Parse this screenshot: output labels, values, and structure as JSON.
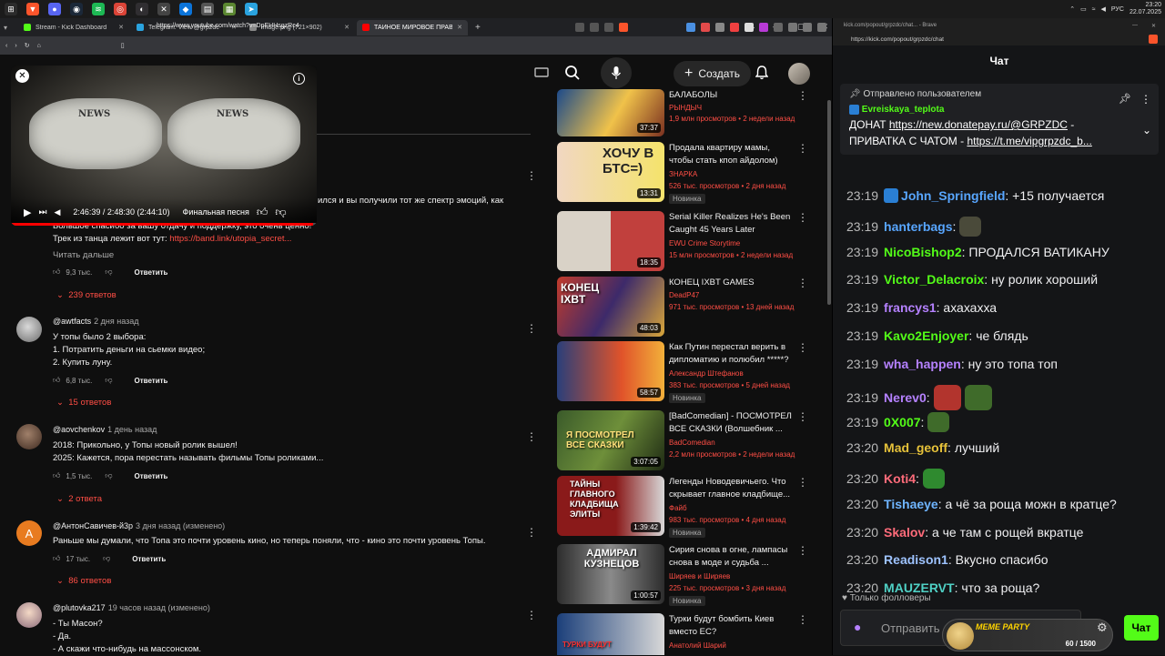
{
  "taskbar": {
    "clock_time": "23:20",
    "clock_date": "22.07.2025",
    "lang": "РУС"
  },
  "browser": {
    "tabs": [
      {
        "label": "Stream - Kick Dashboard",
        "color": "#53fc18"
      },
      {
        "label": "Telegram: View @grpzdc",
        "color": "#2aa3df"
      },
      {
        "label": "image.png (721×902)",
        "color": "#888888"
      },
      {
        "label": "ТАЙНОЕ МИРОВОЕ ПРАВИТЕЛ...",
        "color": "#ff0000"
      }
    ],
    "url": "https://www.youtube.com/watch?v=DpEHHsgzRc4"
  },
  "yt": {
    "create_label": "Создать",
    "miniplayer": {
      "time": "2:46:39 / 2:48:30 (2:44:10)",
      "chapter": "Финальная песня",
      "progress": 0.988,
      "newspaper_word": "NEWS"
    },
    "top_comment": {
      "line1": "ился и вы получили тот же спектр эмоций, как",
      "line2": "Большое спасибо за вашу отдачу и поддержку, это очень ценно!",
      "line3_prefix": "Трек из танца лежит вот тут: ",
      "line3_link": "https://band.link/utopia_secret...",
      "read_more": "Читать дальше",
      "likes": "9,3 тыс.",
      "reply": "Ответить",
      "replies": "239 ответов"
    },
    "comments": [
      {
        "author": "@awtfacts",
        "time": "2 дня назад",
        "lines": [
          "У топы было 2 выбора:",
          "1. Потратить деньги на сьемки видео;",
          "2. Купить луну."
        ],
        "likes": "6,8 тыс.",
        "reply": "Ответить",
        "replies": "15 ответов"
      },
      {
        "author": "@aovchenkov",
        "time": "1 день назад",
        "lines": [
          "2018: Прикольно, у Топы новый ролик вышел!",
          "2025: Кажется, пора перестать называть фильмы Топы роликами..."
        ],
        "likes": "1,5 тыс.",
        "reply": "Ответить",
        "replies": "2 ответа"
      },
      {
        "author": "@АнтонСавичев-й3р",
        "time": "3 дня назад (изменено)",
        "lines": [
          "Раньше мы думали, что Топа это почти уровень кино, но теперь поняли, что - кино это почти уровень Топы."
        ],
        "likes": "17 тыс.",
        "reply": "Ответить",
        "replies": "86 ответов",
        "avatar_letter": "А"
      },
      {
        "author": "@plutovka217",
        "time": "19 часов назад (изменено)",
        "lines": [
          "- Ты Масон?",
          "- Да.",
          "- А скажи что-нибудь на массонском."
        ]
      }
    ],
    "recommended": [
      {
        "title_lines": [
          "БАЛАБОЛЫ"
        ],
        "channel": "РЫНДЫЧ",
        "meta": "1,9 млн просмотров • 2 недели назад",
        "duration": "37:37"
      },
      {
        "title_lines": [
          "Продала квартиру мамы,",
          "чтобы стать кпоп айдолом)"
        ],
        "channel": "ЗНАРКА",
        "meta": "526 тыс. просмотров • 2 дня назад",
        "duration": "13:31",
        "badge": "Новинка",
        "thumb_text": "ХОЧУ В БТС=)"
      },
      {
        "title_lines": [
          "Serial Killer Realizes He's Been",
          "Caught 45 Years Later"
        ],
        "channel": "EWU Crime Storytime",
        "meta": "15 млн просмотров • 2 недели назад",
        "duration": "18:35"
      },
      {
        "title_lines": [
          "КОНЕЦ IXBT GAMES"
        ],
        "channel": "DeadP47",
        "meta": "971 тыс. просмотров • 13 дней назад",
        "duration": "48:03",
        "thumb_text": "КОНЕЦ IXBT"
      },
      {
        "title_lines": [
          "Как Путин перестал верить в",
          "дипломатию и полюбил *****?"
        ],
        "channel": "Александр Штефанов",
        "meta": "383 тыс. просмотров • 5 дней назад",
        "duration": "58:57",
        "badge": "Новинка"
      },
      {
        "title_lines": [
          "[BadComedian] - ПОСМОТРЕЛ",
          "ВСЕ СКАЗКИ (Волшебник ..."
        ],
        "channel": "BadComedian",
        "meta": "2,2 млн просмотров • 2 недели назад",
        "duration": "3:07:05",
        "thumb_text": "Я ПОСМОТРЕЛ ВСЕ СКАЗКИ"
      },
      {
        "title_lines": [
          "Легенды Новодевичьего. Что",
          "скрывает главное кладбище..."
        ],
        "channel": "Файб",
        "meta": "983 тыс. просмотров • 4 дня назад",
        "duration": "1:39:42",
        "badge": "Новинка",
        "thumb_text": "ТАЙНЫ ГЛАВНОГО КЛАДБИЩА ЭЛИТЫ"
      },
      {
        "title_lines": [
          "Сирия снова в огне, лампасы",
          "снова в моде и судьба ..."
        ],
        "channel": "Ширяев и Ширяев",
        "meta": "225 тыс. просмотров • 3 дня назад",
        "duration": "1:00:57",
        "badge": "Новинка",
        "thumb_text": "АДМИРАЛ КУЗНЕЦОВ"
      },
      {
        "title_lines": [
          "Турки будут бомбить Киев",
          "вместо ЕС?"
        ],
        "channel": "Анатолий Шарий",
        "meta": "",
        "thumb_text": "ТУРКИ БУДУТ"
      }
    ]
  },
  "kick": {
    "window_title": "kick.com/popout/grpzdc/chat... - Brave",
    "url": "https://kick.com/popout/grpzdc/chat",
    "chat_title": "Чат",
    "pinned": {
      "header": "Отправлено пользователем",
      "user": "Evreiskaya_teplota",
      "line1_prefix": "ДОНАТ ",
      "line1_link": "https://new.donatepay.ru/@GRPZDC",
      "line1_suffix": " -",
      "line2_prefix": "ПРИВАТКА С ЧАТОМ - ",
      "line2_link": "https://t.me/vipgrpzdc_b..."
    },
    "messages": [
      {
        "time": "23:19",
        "user": "John_Springfield",
        "color": "#58a6ff",
        "text": ": +15 получается"
      },
      {
        "time": "23:19",
        "user": "hanterbags",
        "color": "#58a6ff",
        "text": ":",
        "emotes": 1
      },
      {
        "time": "23:19",
        "user": "NicoBishop2",
        "color": "#53fc18",
        "text": ": ПРОДАЛСЯ ВАТИКАНУ"
      },
      {
        "time": "23:19",
        "user": "Victor_Delacroix",
        "color": "#53fc18",
        "text": ": ну ролик хороший"
      },
      {
        "time": "23:19",
        "user": "francys1",
        "color": "#b581ff",
        "text": ": ахахахха"
      },
      {
        "time": "23:19",
        "user": "Kavo2Enjoyer",
        "color": "#53fc18",
        "text": ": че блядь"
      },
      {
        "time": "23:19",
        "user": "wha_happen",
        "color": "#b581ff",
        "text": ": ну это топа топ"
      },
      {
        "time": "23:19",
        "user": "Nerev0",
        "color": "#b581ff",
        "text": ":",
        "emotes": 2
      },
      {
        "time": "23:19",
        "user": "0X007",
        "color": "#53fc18",
        "text": ":",
        "emotes": 1
      },
      {
        "time": "23:20",
        "user": "Mad_geoff",
        "color": "#e6c23a",
        "text": ": лучший"
      },
      {
        "time": "23:20",
        "user": "Koti4",
        "color": "#ff6b7a",
        "text": ":",
        "emotes": 1
      },
      {
        "time": "23:20",
        "user": "Tishaeye",
        "color": "#6fb5ff",
        "text": ": а чё за роща можн в кратце?"
      },
      {
        "time": "23:20",
        "user": "Skalov",
        "color": "#ff6b7a",
        "text": ": а че там с рощей вкратце"
      },
      {
        "time": "23:20",
        "user": "Readison1",
        "color": "#9ec3ff",
        "text": ": Вкусно спасибо"
      },
      {
        "time": "23:20",
        "user": "MAUZERVT",
        "color": "#4fd1c5",
        "text": ": что за роща?"
      }
    ],
    "followers_only": "Только фолловеры",
    "input_placeholder": "Отправить",
    "send_label": "Чат",
    "meme_party": {
      "title": "MEME PARTY",
      "count": "60 / 1500"
    }
  }
}
